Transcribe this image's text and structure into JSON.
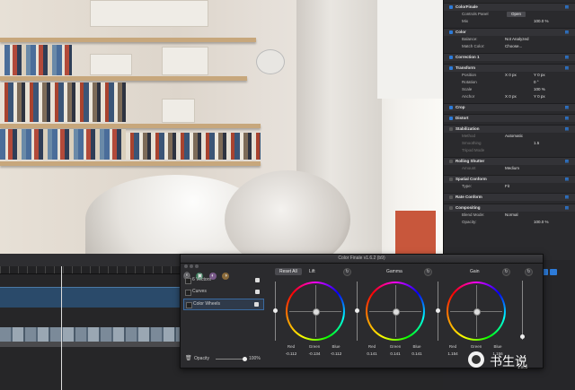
{
  "inspector": {
    "rows": [
      {
        "type": "header",
        "label": "ColorFinale",
        "check": true
      },
      {
        "type": "sub",
        "label": "Controls Panel",
        "button": "Open"
      },
      {
        "type": "sub",
        "label": "Mix",
        "val": "",
        "val2": "100.0 %"
      },
      {
        "type": "header",
        "label": "Color",
        "check": true
      },
      {
        "type": "sub",
        "label": "Balance:",
        "val": "Not Analyzed"
      },
      {
        "type": "sub",
        "label": "Match Color:",
        "val": "Choose..."
      },
      {
        "type": "header",
        "label": "Correction 1",
        "check": true
      },
      {
        "type": "header",
        "label": "Transform",
        "check": true
      },
      {
        "type": "sub",
        "label": "Position",
        "val": "X  0  px",
        "val2": "Y  0  px"
      },
      {
        "type": "sub",
        "label": "Rotation",
        "val": "",
        "val2": "0 °"
      },
      {
        "type": "sub",
        "label": "Scale",
        "val": "",
        "val2": "100 %"
      },
      {
        "type": "sub",
        "label": "Anchor",
        "val": "X  0  px",
        "val2": "Y  0  px"
      },
      {
        "type": "header",
        "label": "Crop",
        "check": true
      },
      {
        "type": "header",
        "label": "Distort",
        "check": true
      },
      {
        "type": "header",
        "label": "Stabilization",
        "check": false
      },
      {
        "type": "sub",
        "label": "Method",
        "val": "Automatic",
        "dim": true
      },
      {
        "type": "sub",
        "label": "Smoothing",
        "val": "",
        "val2": "1.5",
        "dim": true
      },
      {
        "type": "sub",
        "label": "Tripod Mode",
        "val": "",
        "dim": true
      },
      {
        "type": "header",
        "label": "Rolling Shutter",
        "check": false
      },
      {
        "type": "sub",
        "label": "Amount",
        "val": "Medium",
        "dim": true
      },
      {
        "type": "header",
        "label": "Spatial Conform",
        "check": false
      },
      {
        "type": "sub",
        "label": "Type:",
        "val": "Fit"
      },
      {
        "type": "header",
        "label": "Rate Conform",
        "check": false
      },
      {
        "type": "header",
        "label": "Compositing",
        "check": false
      },
      {
        "type": "sub",
        "label": "Blend Mode:",
        "val": "Normal"
      },
      {
        "type": "sub",
        "label": "Opacity:",
        "val": "",
        "val2": "100.0 %"
      }
    ]
  },
  "color_panel": {
    "title": "Color Finale v1.6.2 (b9)",
    "icons": [
      "ⓔ",
      "▣",
      "◐",
      "◑"
    ],
    "list": [
      {
        "label": "6 Vectors",
        "selected": false
      },
      {
        "label": "Curves",
        "selected": false
      },
      {
        "label": "Color Wheels",
        "selected": true
      }
    ],
    "opacity_label": "Opacity",
    "opacity_value": "100%",
    "reset_all": "Reset All",
    "wheels": [
      {
        "name": "Lift",
        "channels": [
          "Red",
          "Green",
          "Blue"
        ],
        "values": [
          "-0.112",
          "-0.134",
          "-0.112"
        ]
      },
      {
        "name": "Gamma",
        "channels": [
          "Red",
          "Green",
          "Blue"
        ],
        "values": [
          "0.141",
          "0.141",
          "0.141"
        ]
      },
      {
        "name": "Gain",
        "channels": [
          "Red",
          "Green",
          "Blue"
        ],
        "values": [
          "1.154",
          "1.188",
          "1.156"
        ]
      }
    ],
    "sat_label": "Sat",
    "sat_value": "1.000"
  },
  "watermark": {
    "text": "书生说"
  },
  "colors": {
    "accent": "#2d7bd9",
    "panel": "#2b2b2e",
    "inspector": "#2a2a2d"
  }
}
